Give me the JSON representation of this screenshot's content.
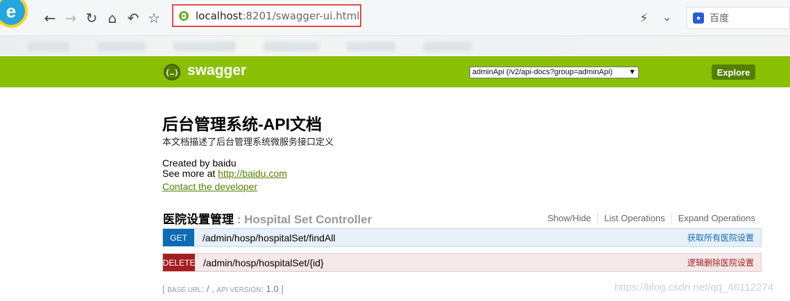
{
  "browser": {
    "address": {
      "host": "localhost",
      "path": ":8201/swagger-ui.html"
    },
    "search_engine": "百度",
    "icons": [
      "back-icon",
      "forward-icon",
      "reload-icon",
      "home-icon",
      "undo-icon",
      "star-icon",
      "bolt-icon",
      "chevron-down-icon"
    ]
  },
  "swagger": {
    "brand": "swagger",
    "api_selector": "adminApi (/v2/api-docs?group=adminApi)",
    "explore_label": "Explore",
    "accent_color": "#89bf04"
  },
  "info": {
    "title": "后台管理系统-API文档",
    "description": "本文档描述了后台管理系统微服务接口定义",
    "created_by": "Created by baidu",
    "see_more_prefix": "See more at ",
    "see_more_link": "http://baidu.com",
    "contact_link": "Contact the developer"
  },
  "resource": {
    "name_cn": "医院设置管理",
    "separator": " : ",
    "name_en": "Hospital Set Controller",
    "ops": {
      "show_hide": "Show/Hide",
      "list": "List Operations",
      "expand": "Expand Operations"
    },
    "endpoints": [
      {
        "method": "GET",
        "path": "/admin/hosp/hospitalSet/findAll",
        "summary": "获取所有医院设置"
      },
      {
        "method": "DELETE",
        "path": "/admin/hosp/hospitalSet/{id}",
        "summary": "逻辑删除医院设置"
      }
    ]
  },
  "footer": {
    "base_url_label": "BASE URL",
    "base_url_value": "/",
    "api_version_label": "API VERSION",
    "api_version_value": "1.0"
  },
  "watermark": "https://blog.csdn.net/qq_46112274"
}
